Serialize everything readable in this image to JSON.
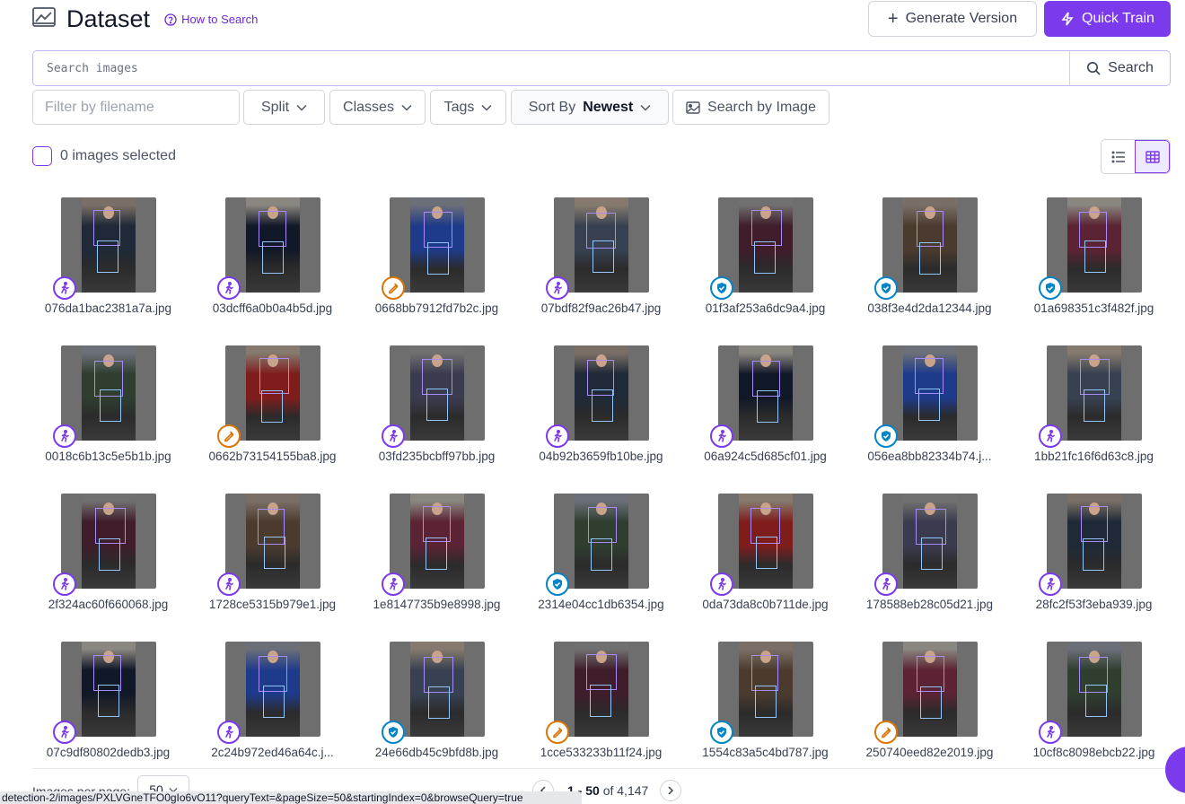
{
  "header": {
    "title": "Dataset",
    "how_to_search": "How to Search",
    "generate_version": "Generate Version",
    "quick_train": "Quick Train",
    "icon": "chart-image-icon"
  },
  "search": {
    "placeholder": "Search images",
    "button_label": "Search"
  },
  "filters": {
    "filename_placeholder": "Filter by filename",
    "split": "Split",
    "classes": "Classes",
    "tags": "Tags",
    "sort_label": "Sort By",
    "sort_value": "Newest",
    "search_by_image": "Search by Image"
  },
  "selection": {
    "text": "0 images selected"
  },
  "colors": {
    "accent": "#7c3aed",
    "badge_annotate": "#7c3aed",
    "badge_review": "#d97706",
    "badge_approved": "#0284c7"
  },
  "images": [
    {
      "name": "076da1bac2381a7a.jpg",
      "badge": "annotate"
    },
    {
      "name": "03dcff6a0b0a4b5d.jpg",
      "badge": "annotate"
    },
    {
      "name": "0668bb7912fd7b2c.jpg",
      "badge": "review"
    },
    {
      "name": "07bdf82f9ac26b47.jpg",
      "badge": "annotate"
    },
    {
      "name": "01f3af253a6dc9a4.jpg",
      "badge": "approved"
    },
    {
      "name": "038f3e4d2da12344.jpg",
      "badge": "approved"
    },
    {
      "name": "01a698351c3f482f.jpg",
      "badge": "approved"
    },
    {
      "name": "0018c6b13c5e5b1b.jpg",
      "badge": "annotate"
    },
    {
      "name": "0662b73154155ba8.jpg",
      "badge": "review"
    },
    {
      "name": "03fd235bcbff97bb.jpg",
      "badge": "annotate"
    },
    {
      "name": "04b92b3659fb10be.jpg",
      "badge": "annotate"
    },
    {
      "name": "06a924c5d685cf01.jpg",
      "badge": "annotate"
    },
    {
      "name": "056ea8bb82334b74.j...",
      "badge": "approved"
    },
    {
      "name": "1bb21fc16f6d63c8.jpg",
      "badge": "annotate"
    },
    {
      "name": "2f324ac60f660068.jpg",
      "badge": "annotate"
    },
    {
      "name": "1728ce5315b979e1.jpg",
      "badge": "annotate"
    },
    {
      "name": "1e8147735b9e8998.jpg",
      "badge": "annotate"
    },
    {
      "name": "2314e04cc1db6354.jpg",
      "badge": "approved"
    },
    {
      "name": "0da73da8c0b711de.jpg",
      "badge": "annotate"
    },
    {
      "name": "178588eb28c05d21.jpg",
      "badge": "annotate"
    },
    {
      "name": "28fc2f53f3eba939.jpg",
      "badge": "annotate"
    },
    {
      "name": "07c9df80802dedb3.jpg",
      "badge": "annotate"
    },
    {
      "name": "2c24b972ed46a64c.j...",
      "badge": "annotate"
    },
    {
      "name": "24e66db45c9bfd8b.jpg",
      "badge": "approved"
    },
    {
      "name": "1cce533233b11f24.jpg",
      "badge": "review"
    },
    {
      "name": "1554c83a5c4bd787.jpg",
      "badge": "approved"
    },
    {
      "name": "250740eed82e2019.jpg",
      "badge": "review"
    },
    {
      "name": "10cf8c8098ebcb22.jpg",
      "badge": "annotate"
    }
  ],
  "footer": {
    "per_page_label": "Images per page:",
    "per_page_value": "50",
    "range": "1 - 50",
    "of_total": "of 4,147"
  },
  "status_bar": {
    "url": "detection-2/images/PXLVGneTFO0gIo6vO11?queryText=&pageSize=50&startingIndex=0&browseQuery=true"
  }
}
